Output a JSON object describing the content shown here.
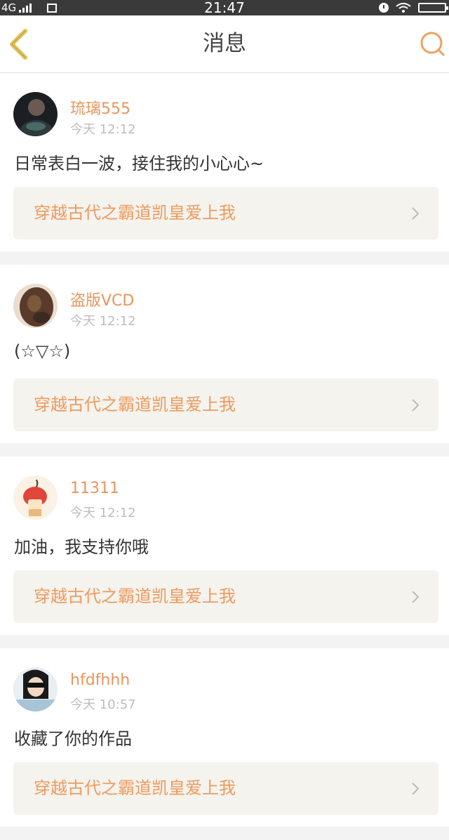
{
  "status_bar": {
    "network": "4G",
    "time": "21:47"
  },
  "header": {
    "title": "消息"
  },
  "colors": {
    "accent": "#e9955c",
    "link_bg": "#f4f3ee"
  },
  "messages": [
    {
      "username": "琉璃555",
      "time": "今天 12:12",
      "text": "日常表白一波，接住我的小心心~",
      "work_title": "穿越古代之霸道凯皇爱上我"
    },
    {
      "username": "盗版VCD",
      "time": "今天 12:12",
      "text": "(☆▽☆)",
      "work_title": "穿越古代之霸道凯皇爱上我"
    },
    {
      "username": "11311",
      "time": "今天 12:12",
      "text": "加油，我支持你哦",
      "work_title": "穿越古代之霸道凯皇爱上我"
    },
    {
      "username": "hfdfhhh",
      "time": "今天 10:57",
      "text": "收藏了你的作品",
      "work_title": "穿越古代之霸道凯皇爱上我"
    }
  ]
}
